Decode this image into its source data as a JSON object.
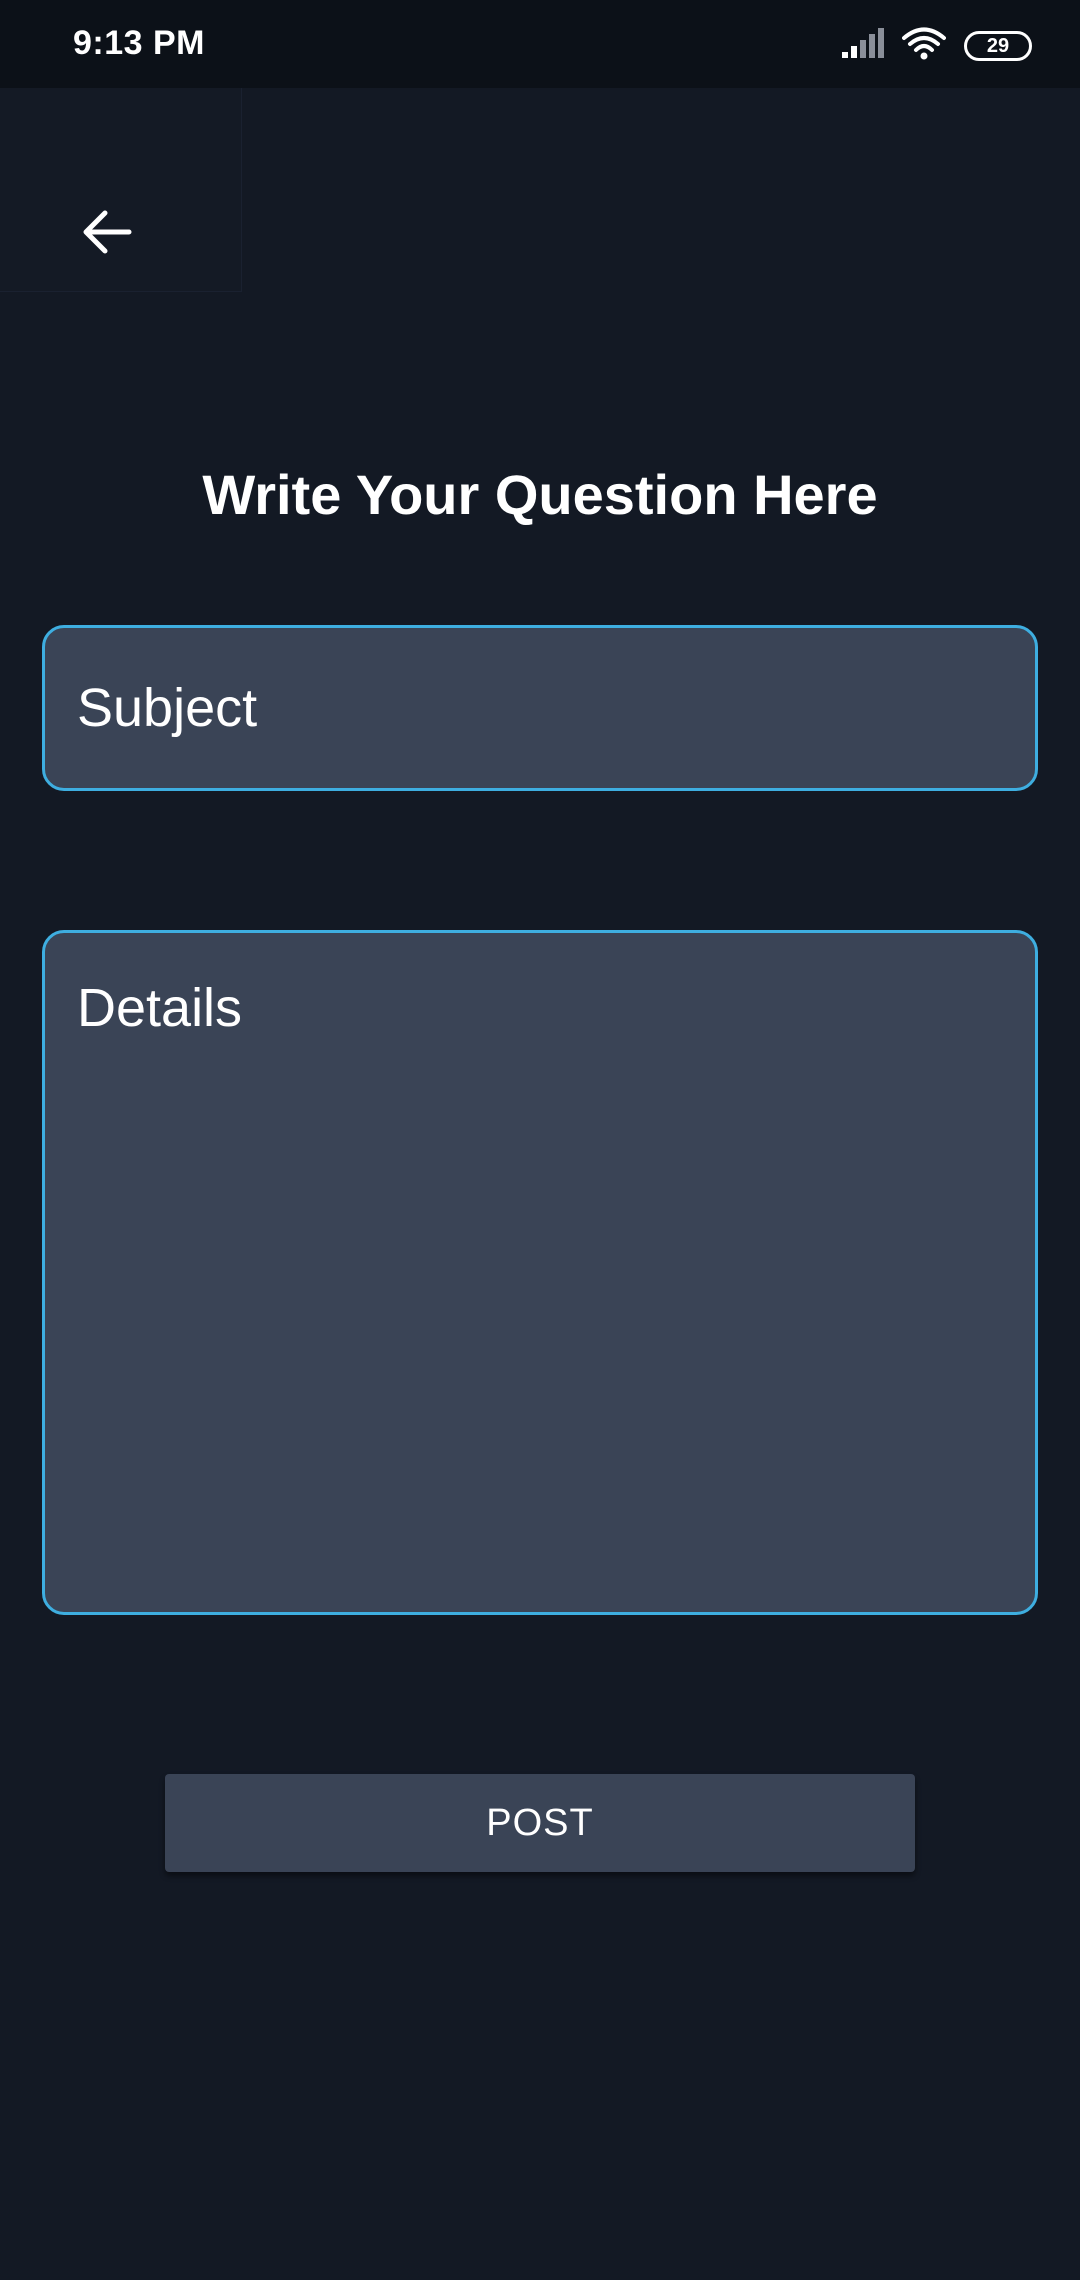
{
  "status_bar": {
    "time": "9:13 PM",
    "battery": "29",
    "icons": [
      "signal-icon",
      "wifi-icon",
      "battery-icon"
    ]
  },
  "header": {
    "back_icon": "arrow-left-icon"
  },
  "form": {
    "title": "Write Your Question Here",
    "subject_placeholder": "Subject",
    "subject_value": "",
    "details_placeholder": "Details",
    "details_value": "",
    "post_label": "POST"
  },
  "colors": {
    "background": "#131924",
    "field_background": "#3a4456",
    "field_border": "#3eaee0",
    "button_background": "#3a4456"
  }
}
